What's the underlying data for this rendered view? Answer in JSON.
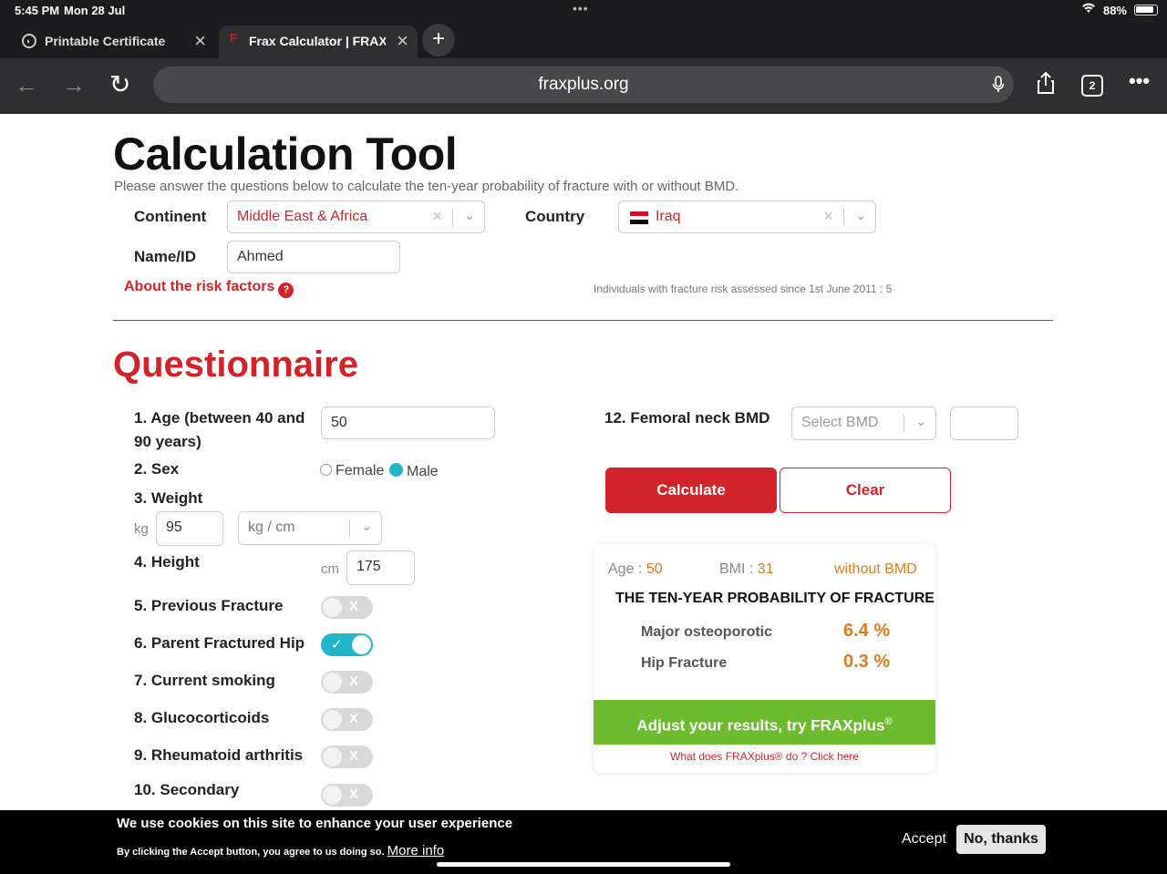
{
  "status": {
    "time": "5:45 PM",
    "date": "Mon 28 Jul",
    "battery": "88%"
  },
  "tabs": [
    {
      "label": "Printable Certificate"
    },
    {
      "label": "Frax Calculator | FRAXplus"
    }
  ],
  "toolbar": {
    "url": "fraxplus.org",
    "tab_count": "2"
  },
  "page": {
    "title": "Calculation Tool",
    "subtitle": "Please answer the questions below to calculate the ten-year probability of fracture with or without BMD.",
    "continent_label": "Continent",
    "continent_value": "Middle East & Africa",
    "country_label": "Country",
    "country_value": "Iraq",
    "name_label": "Name/ID",
    "name_value": "Ahmed",
    "risk_link": "About the risk factors",
    "individuals": "Individuals with fracture risk assessed since 1st June 2011 : 5",
    "questionnaire_title": "Questionnaire"
  },
  "questions": {
    "q1_label": "1. Age (between 40 and 90 years)",
    "q1_value": "50",
    "q2_label": "2. Sex",
    "q2_female": "Female",
    "q2_male": "Male",
    "q3_label": "3. Weight",
    "q3_unit": "kg",
    "q3_value": "95",
    "q3_units_select": "kg / cm",
    "q4_label": "4. Height",
    "q4_unit": "cm",
    "q4_value": "175",
    "q5_label": "5. Previous Fracture",
    "q6_label": "6. Parent Fractured Hip",
    "q7_label": "7. Current smoking",
    "q8_label": "8. Glucocorticoids",
    "q9_label": "9. Rheumatoid arthritis",
    "q10_label": "10. Secondary",
    "q12_label": "12. Femoral neck BMD",
    "q12_placeholder": "Select BMD",
    "toggle_off_mark": "X",
    "toggle_on_mark": "✓"
  },
  "actions": {
    "calculate": "Calculate",
    "clear": "Clear"
  },
  "result": {
    "age_label": "Age :",
    "age_value": "50",
    "bmi_label": "BMI :",
    "bmi_value": "31",
    "mode": "without BMD",
    "heading": "THE TEN-YEAR PROBABILITY OF FRACTURE",
    "major_label": "Major osteoporotic",
    "major_value": "6.4 %",
    "hip_label": "Hip Fracture",
    "hip_value": "0.3 %",
    "adjust_button": "Adjust your results, try FRAXplus",
    "what_does": "What does FRAXplus® do ? Click here"
  },
  "cookie": {
    "title": "We use cookies on this site to enhance your user experience",
    "text": "By clicking the Accept button, you agree to us doing so.",
    "more_info": "More info",
    "accept": "Accept",
    "no_thanks": "No, thanks"
  },
  "colors": {
    "brand_red": "#d2232a",
    "toggle_on": "#22b4c9",
    "result_orange": "#e07a1f",
    "adjust_green": "#6dbb2f"
  }
}
